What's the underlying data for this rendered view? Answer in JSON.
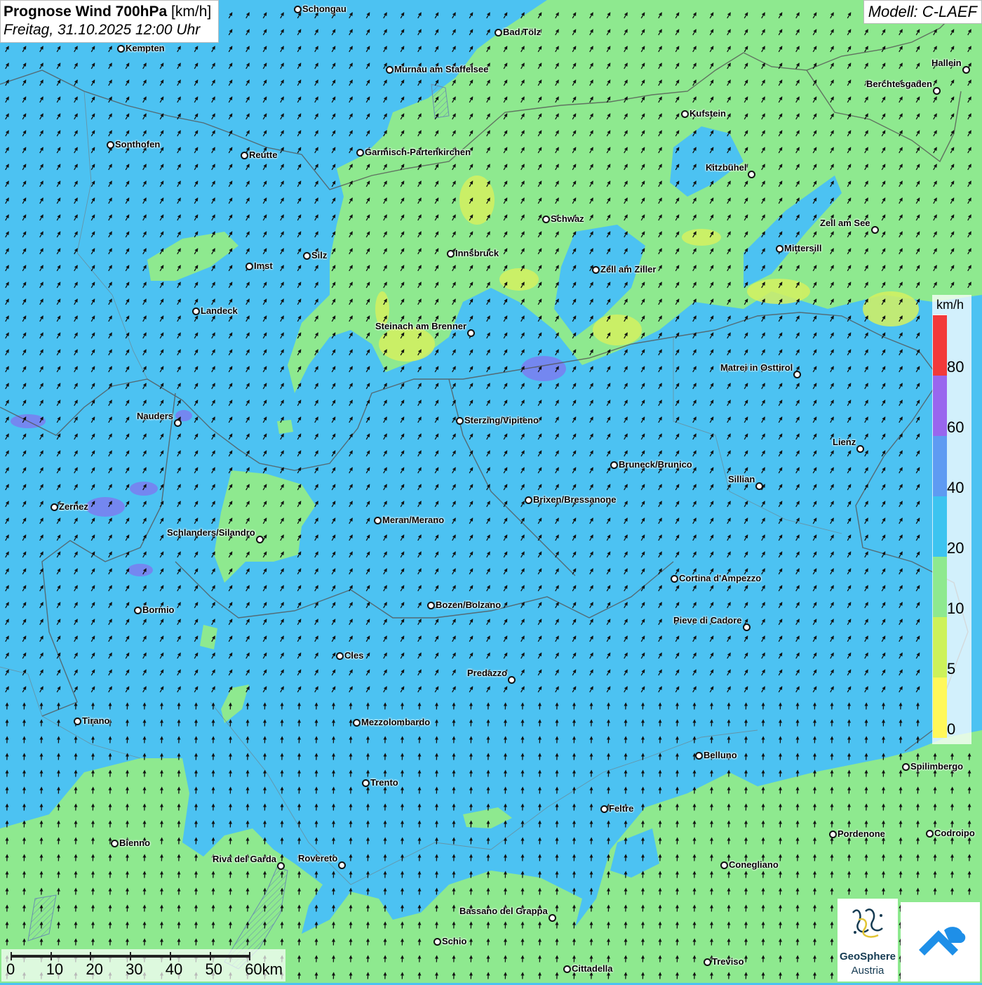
{
  "header": {
    "title_bold": "Prognose Wind 700hPa",
    "title_unit": " [km/h]",
    "datetime": "Freitag, 31.10.2025 12:00 Uhr"
  },
  "model": {
    "label": "Modell: C-LAEF"
  },
  "legend": {
    "unit": "km/h",
    "bands": [
      {
        "color": "#fff85a",
        "label": "0"
      },
      {
        "color": "#cdf25a",
        "label": "5"
      },
      {
        "color": "#8ee98f",
        "label": "10"
      },
      {
        "color": "#3cc4f0",
        "label": "20"
      },
      {
        "color": "#5e9bf2",
        "label": "40"
      },
      {
        "color": "#9966ee",
        "label": "60"
      },
      {
        "color": "#f23a3a",
        "label": "80"
      }
    ]
  },
  "scale": {
    "labels": [
      "0",
      "10",
      "20",
      "30",
      "40",
      "50",
      "60km"
    ]
  },
  "cities": [
    {
      "name": "Schongau",
      "dot_left": true
    },
    {
      "name": "Bad Tölz",
      "dot_left": true
    },
    {
      "name": "Kempten",
      "dot_left": true
    },
    {
      "name": "Murnau am Staffelsee",
      "dot_left": true
    },
    {
      "name": "Hallein",
      "dot_left": false
    },
    {
      "name": "Berchtesgaden",
      "dot_left": false
    },
    {
      "name": "Kufstein",
      "dot_left": true
    },
    {
      "name": "Sonthofen",
      "dot_left": true
    },
    {
      "name": "Reutte",
      "dot_left": true
    },
    {
      "name": "Garmisch-Partenkirchen",
      "dot_left": true
    },
    {
      "name": "Kitzbühel",
      "dot_left": false
    },
    {
      "name": "Schwaz",
      "dot_left": true
    },
    {
      "name": "Zell am See",
      "dot_left": false
    },
    {
      "name": "Mittersill",
      "dot_left": true
    },
    {
      "name": "Innsbruck",
      "dot_left": true
    },
    {
      "name": "Imst",
      "dot_left": true
    },
    {
      "name": "Silz",
      "dot_left": true
    },
    {
      "name": "Zell am Ziller",
      "dot_left": true
    },
    {
      "name": "Landeck",
      "dot_left": true
    },
    {
      "name": "Steinach am Brenner",
      "dot_left": false
    },
    {
      "name": "Matrei in Osttirol",
      "dot_left": false
    },
    {
      "name": "Nauders",
      "dot_left": false
    },
    {
      "name": "Sterzing/Vipiteno",
      "dot_left": true
    },
    {
      "name": "Lienz",
      "dot_left": false
    },
    {
      "name": "Bruneck/Brunico",
      "dot_left": true
    },
    {
      "name": "Sillian",
      "dot_left": false
    },
    {
      "name": "Zernez",
      "dot_left": true
    },
    {
      "name": "Brixen/Bressanone",
      "dot_left": true
    },
    {
      "name": "Meran/Merano",
      "dot_left": true
    },
    {
      "name": "Schlanders/Silandro",
      "dot_left": false
    },
    {
      "name": "Cortina d'Ampezzo",
      "dot_left": true
    },
    {
      "name": "Bozen/Bolzano",
      "dot_left": true
    },
    {
      "name": "Bormio",
      "dot_left": true
    },
    {
      "name": "Pieve di Cadore",
      "dot_left": false
    },
    {
      "name": "Cles",
      "dot_left": true
    },
    {
      "name": "Predazzo",
      "dot_left": false
    },
    {
      "name": "Tirano",
      "dot_left": true
    },
    {
      "name": "Mezzolombardo",
      "dot_left": true
    },
    {
      "name": "Belluno",
      "dot_left": true
    },
    {
      "name": "Spilimbergo",
      "dot_left": true
    },
    {
      "name": "Trento",
      "dot_left": true
    },
    {
      "name": "Feltre",
      "dot_left": true
    },
    {
      "name": "Pordenone",
      "dot_left": true
    },
    {
      "name": "Codroipo",
      "dot_left": true
    },
    {
      "name": "Bienno",
      "dot_left": true
    },
    {
      "name": "Riva del Garda",
      "dot_left": false
    },
    {
      "name": "Rovereto",
      "dot_left": false
    },
    {
      "name": "Conegliano",
      "dot_left": true
    },
    {
      "name": "Bassano del Grappa",
      "dot_left": false
    },
    {
      "name": "Schio",
      "dot_left": true
    },
    {
      "name": "Treviso",
      "dot_left": true
    },
    {
      "name": "Cittadella",
      "dot_left": true
    }
  ],
  "logos": {
    "geosphere_line1": "GeoSphere",
    "geosphere_line2": "Austria"
  }
}
